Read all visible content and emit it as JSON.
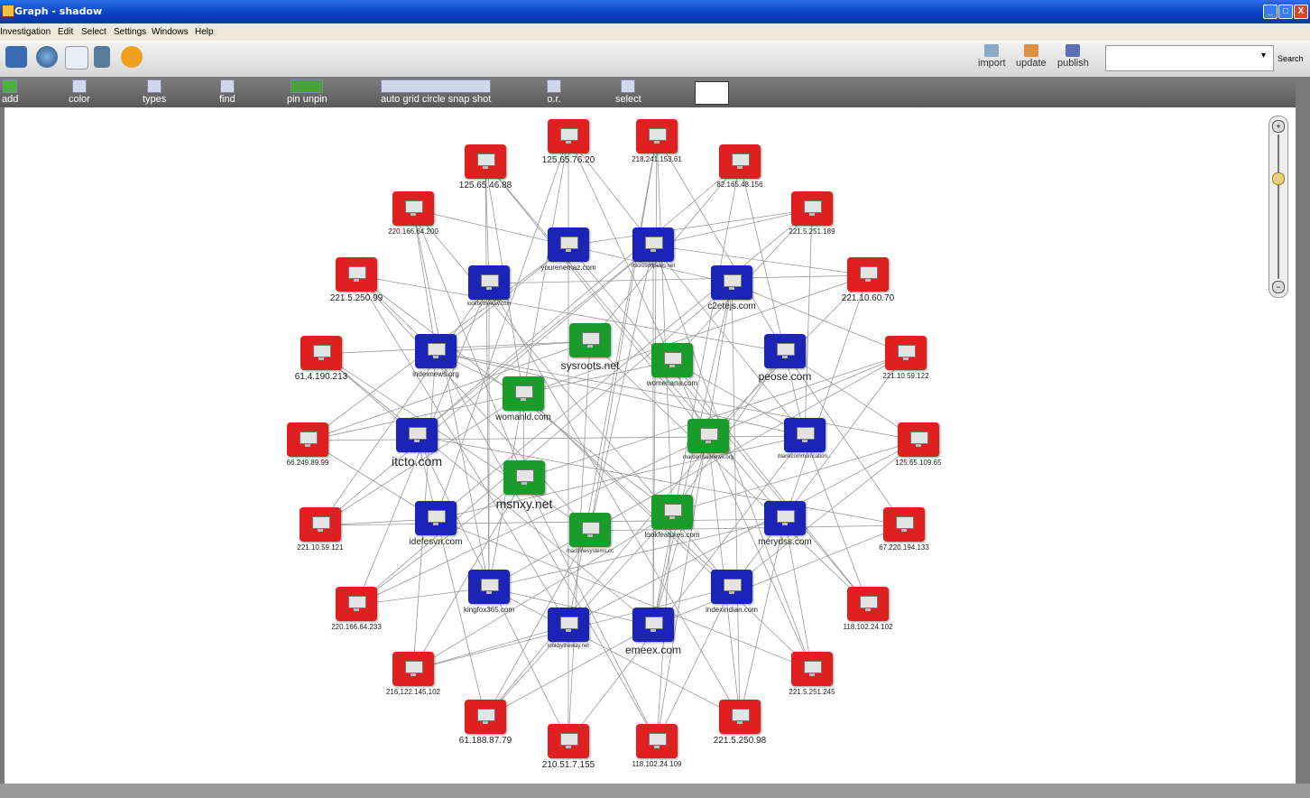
{
  "window": {
    "title": "Graph - shadow",
    "buttons": [
      "_",
      "□",
      "X"
    ]
  },
  "menu": [
    "Investigation",
    "Edit",
    "Select",
    "Settings",
    "Windows",
    "Help"
  ],
  "toolbar_top": {
    "icons": [
      "graph-tool-icon",
      "globe-icon",
      "document-icon",
      "database-icon",
      "info-icon"
    ],
    "actions": [
      {
        "label": "import"
      },
      {
        "label": "update"
      },
      {
        "label": "publish"
      }
    ],
    "search": {
      "value": "",
      "button": "Search"
    }
  },
  "toolbar_graph": [
    {
      "label": "add"
    },
    {
      "label": "color"
    },
    {
      "label": "types"
    },
    {
      "label": "find"
    },
    {
      "label": "pin unpin"
    },
    {
      "label": "auto grid circle snap shot"
    },
    {
      "label": "o.r."
    },
    {
      "label": "select"
    }
  ],
  "nodes": [
    {
      "id": "n1",
      "label": "125.65.76.20",
      "color": "red",
      "size": "m"
    },
    {
      "id": "n2",
      "label": "218.241.153.61",
      "color": "red",
      "size": "s"
    },
    {
      "id": "n3",
      "label": "125.65.46.88",
      "color": "red",
      "size": "m"
    },
    {
      "id": "n4",
      "label": "82.165.48.156",
      "color": "red",
      "size": "s"
    },
    {
      "id": "n5",
      "label": "220.166.64.200",
      "color": "red",
      "size": "s"
    },
    {
      "id": "n6",
      "label": "221.5.251.189",
      "color": "red",
      "size": "s"
    },
    {
      "id": "n7",
      "label": "221.5.250.99",
      "color": "red",
      "size": "m"
    },
    {
      "id": "n8",
      "label": "221.10.60.70",
      "color": "red",
      "size": "m"
    },
    {
      "id": "n9",
      "label": "61.4.190.213",
      "color": "red",
      "size": "m"
    },
    {
      "id": "n10",
      "label": "221.10.59.122",
      "color": "red",
      "size": "s"
    },
    {
      "id": "n11",
      "label": "66.249.89.99",
      "color": "red",
      "size": "s"
    },
    {
      "id": "n12",
      "label": "125.65.109.65",
      "color": "red",
      "size": "s"
    },
    {
      "id": "n13",
      "label": "221.10.59.121",
      "color": "red",
      "size": "s"
    },
    {
      "id": "n14",
      "label": "67.220.194.133",
      "color": "red",
      "size": "s"
    },
    {
      "id": "n15",
      "label": "220.166.64.233",
      "color": "red",
      "size": "s"
    },
    {
      "id": "n16",
      "label": "118.102.24.102",
      "color": "red",
      "size": "s"
    },
    {
      "id": "n17",
      "label": "216.122.145.102",
      "color": "red",
      "size": "s"
    },
    {
      "id": "n18",
      "label": "221.5.251.245",
      "color": "red",
      "size": "s"
    },
    {
      "id": "n19",
      "label": "61.188.87.79",
      "color": "red",
      "size": "m"
    },
    {
      "id": "n20",
      "label": "221.5.250.98",
      "color": "red",
      "size": "m"
    },
    {
      "id": "n21",
      "label": "210.51.7.155",
      "color": "red",
      "size": "m"
    },
    {
      "id": "n22",
      "label": "118.102.24.109",
      "color": "red",
      "size": "s"
    },
    {
      "id": "n23",
      "label": "yourenemaz.com",
      "color": "blue",
      "size": "s"
    },
    {
      "id": "n24",
      "label": "microsoftpews.net",
      "color": "blue",
      "size": "xs"
    },
    {
      "id": "n25",
      "label": "lookbytheway.com",
      "color": "blue",
      "size": "xs"
    },
    {
      "id": "n26",
      "label": "c2etejs.com",
      "color": "blue",
      "size": "m"
    },
    {
      "id": "n27",
      "label": "indexnews.org",
      "color": "blue",
      "size": "s"
    },
    {
      "id": "n28",
      "label": "peose.com",
      "color": "blue",
      "size": "l"
    },
    {
      "id": "n29",
      "label": "itcto.com",
      "color": "blue",
      "size": "xl"
    },
    {
      "id": "n30",
      "label": "blankcommunication...",
      "color": "blue",
      "size": "xs"
    },
    {
      "id": "n31",
      "label": "idefesvn.com",
      "color": "blue",
      "size": "m"
    },
    {
      "id": "n32",
      "label": "merydss.com",
      "color": "blue",
      "size": "m"
    },
    {
      "id": "n33",
      "label": "kingfox365.com",
      "color": "blue",
      "size": "s"
    },
    {
      "id": "n34",
      "label": "indexindian.com",
      "color": "blue",
      "size": "s"
    },
    {
      "id": "n35",
      "label": "lookbytheway.net",
      "color": "blue",
      "size": "xs"
    },
    {
      "id": "n36",
      "label": "emeex.com",
      "color": "blue",
      "size": "l"
    },
    {
      "id": "n37",
      "label": "sysroots.net",
      "color": "green",
      "size": "l"
    },
    {
      "id": "n38",
      "label": "womenana.com",
      "color": "green",
      "size": "s"
    },
    {
      "id": "n39",
      "label": "womanld.com",
      "color": "green",
      "size": "m"
    },
    {
      "id": "n40",
      "label": "mardonnainnews.org",
      "color": "green",
      "size": "xs"
    },
    {
      "id": "n41",
      "label": "msnxy.net",
      "color": "green",
      "size": "xl"
    },
    {
      "id": "n42",
      "label": "lookfeatures.com",
      "color": "green",
      "size": "s"
    },
    {
      "id": "n43",
      "label": "machinesystems.cc",
      "color": "green",
      "size": "xs"
    }
  ],
  "colors": {
    "red": "#e02020",
    "blue": "#1c24b8",
    "green": "#1a9c2a",
    "edge": "#9a9a9a"
  }
}
